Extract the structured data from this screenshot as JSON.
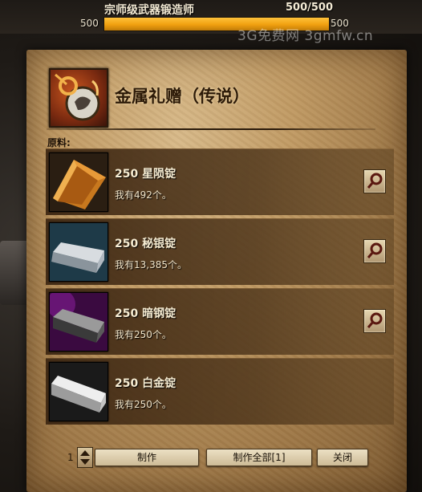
{
  "header": {
    "discipline_title": "宗师级武器锻造师",
    "progress_text": "500/500",
    "bar_min": "500",
    "bar_max": "500",
    "progress_fraction": 1.0
  },
  "watermark": "3G免费网 3gmfw.cn",
  "recipe": {
    "title": "金属礼赠（传说）",
    "materials_label": "原料:"
  },
  "materials": [
    {
      "name": "250 星陨锭",
      "owned": "我有492个。",
      "icon": "orichalcum-ingot-icon",
      "has_search": true
    },
    {
      "name": "250 秘银锭",
      "owned": "我有13,385个。",
      "icon": "mithril-ingot-icon",
      "has_search": true
    },
    {
      "name": "250 暗钢锭",
      "owned": "我有250个。",
      "icon": "darksteel-ingot-icon",
      "has_search": true
    },
    {
      "name": "250 白金锭",
      "owned": "我有250个。",
      "icon": "platinum-ingot-icon",
      "has_search": false
    }
  ],
  "controls": {
    "quantity": "1",
    "craft_label": "制作",
    "craft_all_label": "制作全部[1]",
    "close_label": "关闭"
  },
  "colors": {
    "progress_fill": "#f0a010",
    "parchment": "#c09a64",
    "row_bg": "#3c2612"
  }
}
